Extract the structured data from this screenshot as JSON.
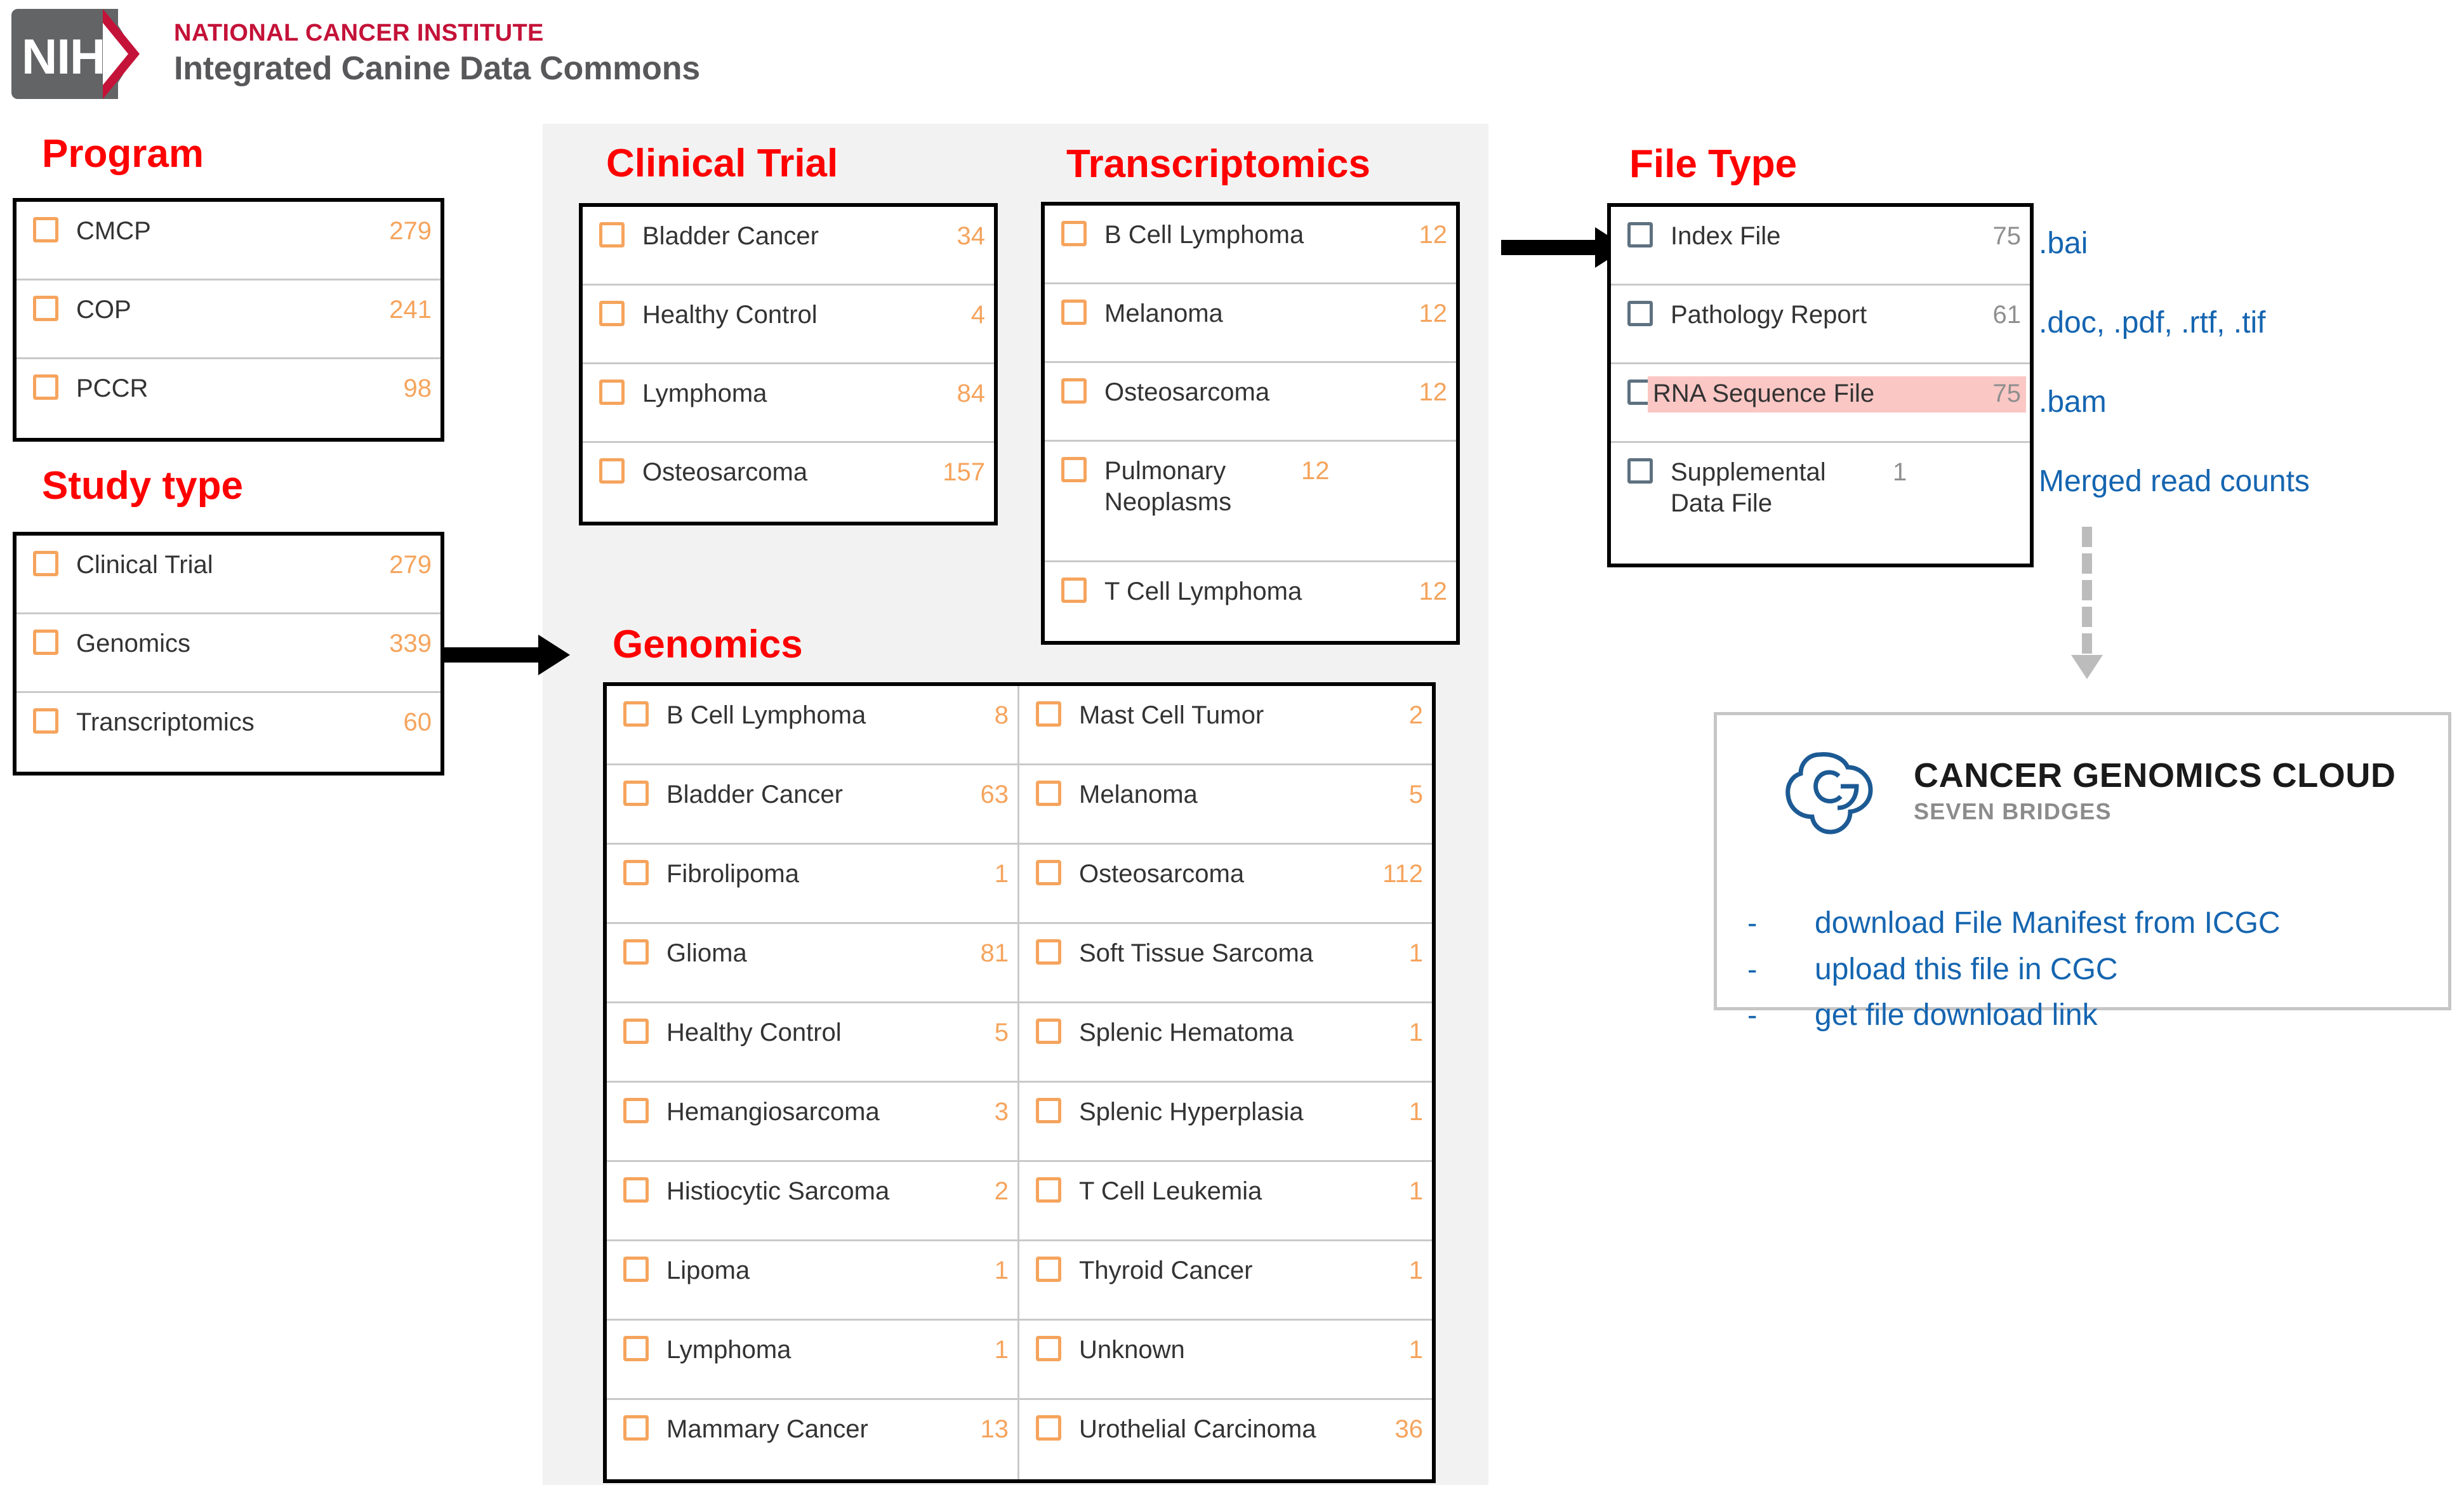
{
  "header": {
    "logo_letters": "NIH",
    "institute": "NATIONAL CANCER INSTITUTE",
    "product": "Integrated Canine Data Commons"
  },
  "sections": {
    "program": {
      "label": "Program",
      "items": [
        {
          "label": "CMCP",
          "count": "279"
        },
        {
          "label": "COP",
          "count": "241"
        },
        {
          "label": "PCCR",
          "count": "98"
        }
      ]
    },
    "study_type": {
      "label": "Study type",
      "items": [
        {
          "label": "Clinical Trial",
          "count": "279"
        },
        {
          "label": "Genomics",
          "count": "339"
        },
        {
          "label": "Transcriptomics",
          "count": "60"
        }
      ]
    },
    "clinical_trial": {
      "label": "Clinical Trial",
      "items": [
        {
          "label": "Bladder Cancer",
          "count": "34"
        },
        {
          "label": "Healthy Control",
          "count": "4"
        },
        {
          "label": "Lymphoma",
          "count": "84"
        },
        {
          "label": "Osteosarcoma",
          "count": "157"
        }
      ]
    },
    "transcriptomics": {
      "label": "Transcriptomics",
      "items": [
        {
          "label": "B Cell Lymphoma",
          "count": "12"
        },
        {
          "label": "Melanoma",
          "count": "12"
        },
        {
          "label": "Osteosarcoma",
          "count": "12"
        },
        {
          "label": "Pulmonary Neoplasms",
          "count": "12"
        },
        {
          "label": "T Cell Lymphoma",
          "count": "12"
        }
      ]
    },
    "genomics": {
      "label": "Genomics",
      "left_items": [
        {
          "label": "B Cell Lymphoma",
          "count": "8"
        },
        {
          "label": "Bladder Cancer",
          "count": "63"
        },
        {
          "label": "Fibrolipoma",
          "count": "1"
        },
        {
          "label": "Glioma",
          "count": "81"
        },
        {
          "label": "Healthy Control",
          "count": "5"
        },
        {
          "label": "Hemangiosarcoma",
          "count": "3"
        },
        {
          "label": "Histiocytic Sarcoma",
          "count": "2"
        },
        {
          "label": "Lipoma",
          "count": "1"
        },
        {
          "label": "Lymphoma",
          "count": "1"
        },
        {
          "label": "Mammary Cancer",
          "count": "13"
        }
      ],
      "right_items": [
        {
          "label": "Mast Cell Tumor",
          "count": "2"
        },
        {
          "label": "Melanoma",
          "count": "5"
        },
        {
          "label": "Osteosarcoma",
          "count": "112"
        },
        {
          "label": "Soft Tissue Sarcoma",
          "count": "1"
        },
        {
          "label": "Splenic Hematoma",
          "count": "1"
        },
        {
          "label": "Splenic Hyperplasia",
          "count": "1"
        },
        {
          "label": "T Cell Leukemia",
          "count": "1"
        },
        {
          "label": "Thyroid Cancer",
          "count": "1"
        },
        {
          "label": "Unknown",
          "count": "1"
        },
        {
          "label": "Urothelial Carcinoma",
          "count": "36"
        }
      ]
    },
    "file_type": {
      "label": "File Type",
      "items": [
        {
          "label": "Index File",
          "count": "75",
          "highlighted": false
        },
        {
          "label": "Pathology Report",
          "count": "61",
          "highlighted": false
        },
        {
          "label": "RNA Sequence File",
          "count": "75",
          "highlighted": true
        },
        {
          "label": "Supplemental Data File",
          "count": "1",
          "highlighted": false
        }
      ]
    }
  },
  "annotations": {
    "ext_bai": ".bai",
    "ext_docs": ".doc, .pdf, .rtf, .tif",
    "ext_bam": ".bam",
    "merged_read_counts": "Merged read counts"
  },
  "cgc": {
    "title": "CANCER GENOMICS CLOUD",
    "subtitle": "SEVEN BRIDGES",
    "bullet_marker": "-",
    "steps": [
      "download File Manifest from ICGC",
      "upload this file in CGC",
      "get file download link"
    ]
  },
  "colors": {
    "accent_red": "#ff0000",
    "nci_crimson": "#c41238",
    "checkbox_orange": "#f5a45d",
    "checkbox_slate": "#5e7180",
    "link_blue": "#1565b0",
    "highlight_pink": "#fac7c4",
    "panel_grey": "#f2f2f2"
  }
}
